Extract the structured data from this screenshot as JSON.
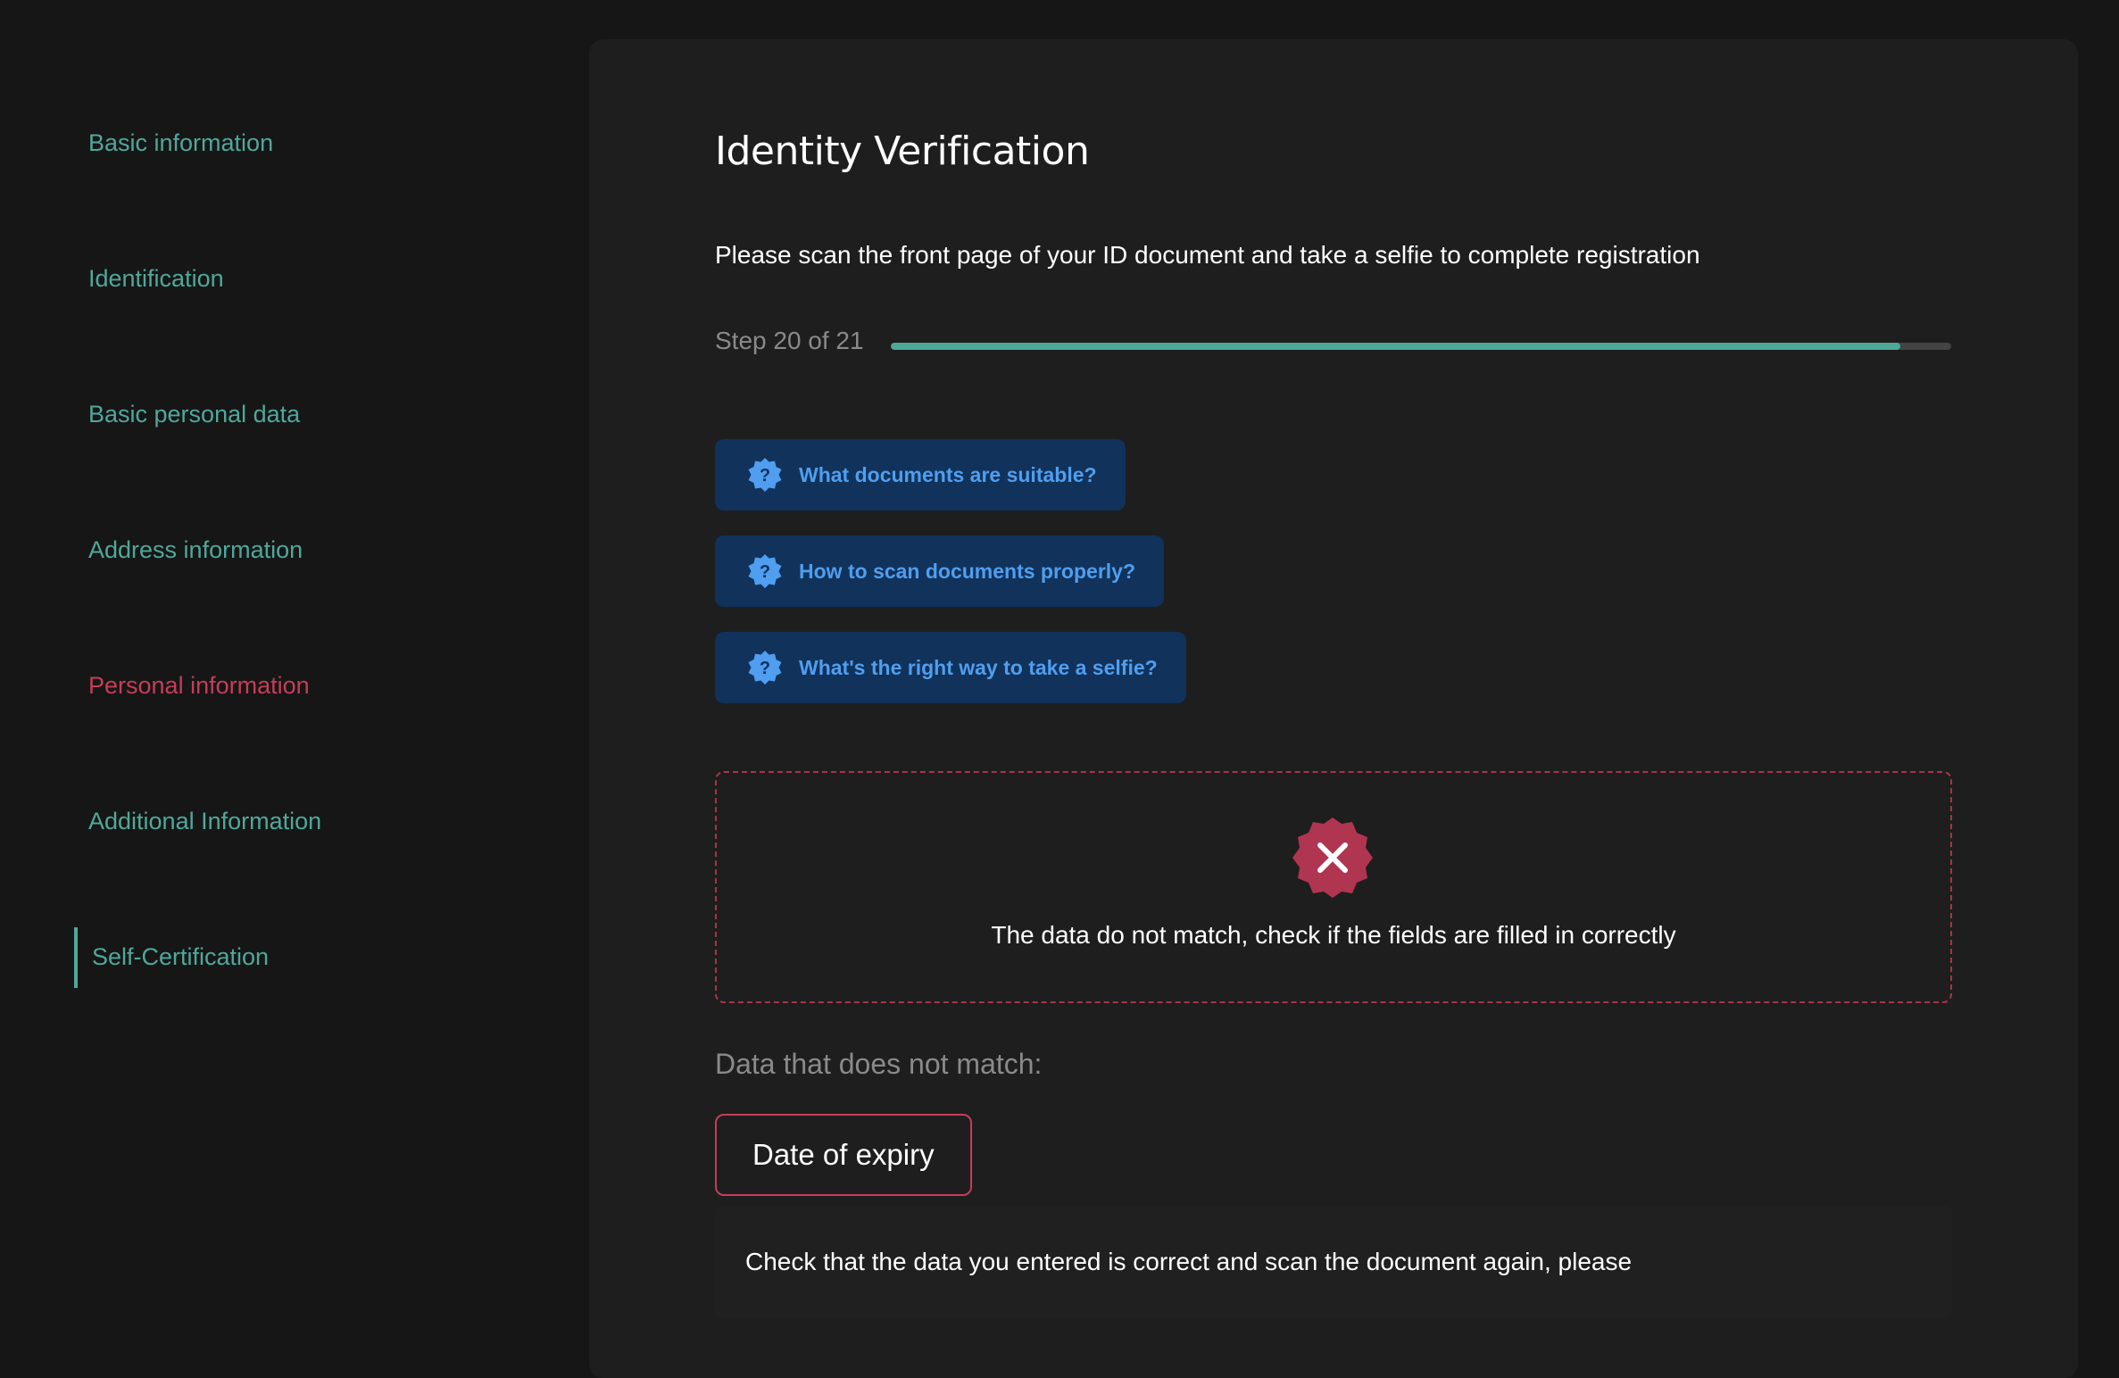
{
  "sidebar": {
    "items": [
      {
        "label": "Basic information",
        "state": "complete"
      },
      {
        "label": "Identification",
        "state": "complete"
      },
      {
        "label": "Basic personal data",
        "state": "complete"
      },
      {
        "label": "Address information",
        "state": "complete"
      },
      {
        "label": "Personal information",
        "state": "error"
      },
      {
        "label": "Additional Information",
        "state": "complete"
      },
      {
        "label": "Self-Certification",
        "state": "active"
      }
    ]
  },
  "main": {
    "title": "Identity Verification",
    "subtitle": "Please scan the front page of your ID document and take a selfie to complete registration",
    "progress": {
      "label": "Step 20 of 21",
      "current": 20,
      "total": 21
    },
    "help_buttons": [
      {
        "label": "What documents are suitable?",
        "icon": "question-badge-icon"
      },
      {
        "label": "How to scan documents properly?",
        "icon": "question-badge-icon"
      },
      {
        "label": "What's the right way to take a selfie?",
        "icon": "question-badge-icon"
      }
    ],
    "error": {
      "icon": "error-badge-icon",
      "message": "The data do not match, check if the fields are filled in correctly"
    },
    "mismatch": {
      "heading": "Data that does not match:",
      "fields": [
        "Date of expiry"
      ],
      "hint": "Check that the data you entered is correct and scan the document again, please"
    }
  },
  "colors": {
    "background": "#161616",
    "panel": "#1e1e1e",
    "accent_teal": "#4fa89a",
    "error_red": "#c53d5a",
    "help_button_bg": "#11325a",
    "help_button_text": "#4f9ef0"
  }
}
